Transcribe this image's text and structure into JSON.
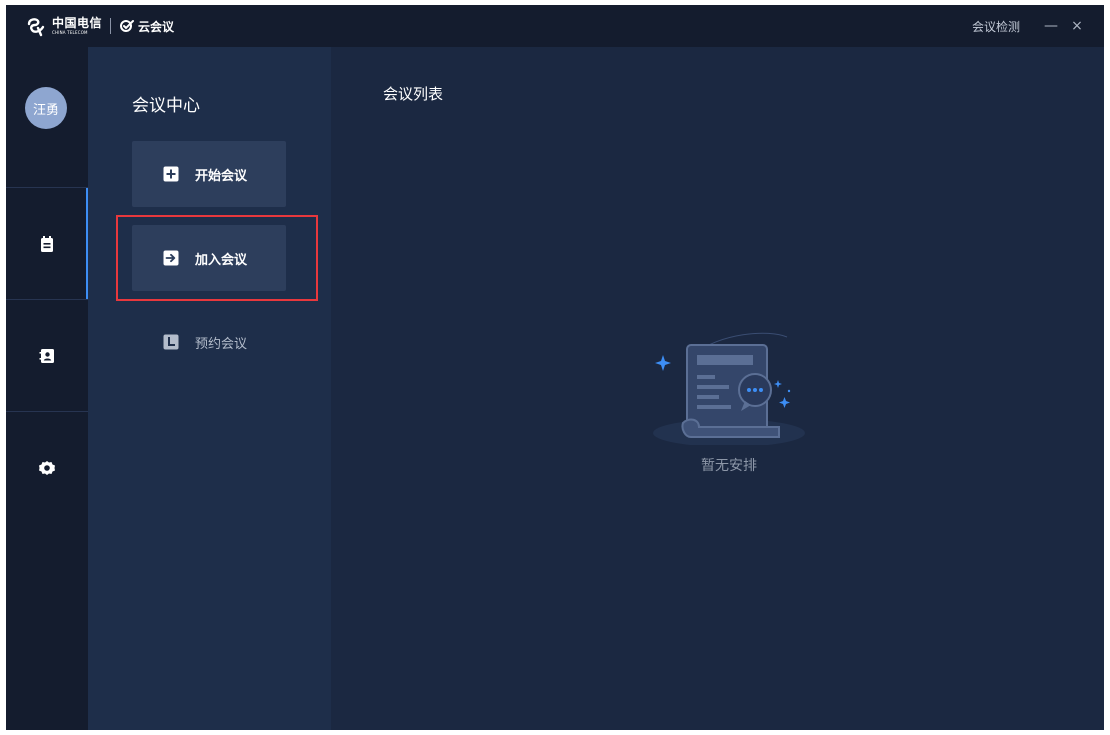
{
  "titlebar": {
    "brand_cn": "中国电信",
    "brand_en": "CHINA TELECOM",
    "app_name": "云会议",
    "detect_label": "会议检测",
    "minimize_glyph": "—",
    "close_glyph": "×"
  },
  "rail": {
    "avatar_text": "汪勇",
    "items": [
      {
        "icon": "calendar-icon",
        "active": true
      },
      {
        "icon": "contacts-icon",
        "active": false
      },
      {
        "icon": "settings-icon",
        "active": false
      }
    ],
    "accent_color": "#3d8ef5"
  },
  "panel": {
    "title": "会议中心",
    "actions": [
      {
        "label": "开始会议",
        "icon": "plus-square-icon"
      },
      {
        "label": "加入会议",
        "icon": "enter-arrow-icon"
      },
      {
        "label": "预约会议",
        "icon": "schedule-icon"
      }
    ],
    "highlight_color": "#e8383d"
  },
  "main": {
    "title": "会议列表",
    "empty_text": "暂无安排"
  }
}
